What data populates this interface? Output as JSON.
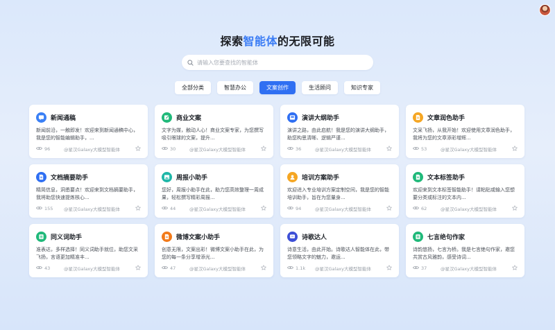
{
  "header": {
    "title_prefix": "探索",
    "title_highlight": "智能体",
    "title_suffix": "的无限可能"
  },
  "search": {
    "placeholder": "请输入您要查找的智能体"
  },
  "tabs": [
    {
      "label": "全部分类",
      "active": false
    },
    {
      "label": "智慧办公",
      "active": false
    },
    {
      "label": "文案创作",
      "active": true
    },
    {
      "label": "生活顾问",
      "active": false
    },
    {
      "label": "知识专家",
      "active": false
    }
  ],
  "cards": [
    {
      "title": "新闻通稿",
      "desc": "新闻前沿，一触即发！欢迎来到新闻通稿中心，我是您的智能编辑助手，...",
      "views": "96",
      "author": "@星汉Galaxy大模型智能体",
      "icon": "message-icon",
      "color": "#3a80f5"
    },
    {
      "title": "商业文案",
      "desc": "文字为媒，触动人心！商业文案专家，为您撰写吸引眼球的文案，提升...",
      "views": "30",
      "author": "@星汉Galaxy大模型智能体",
      "icon": "edit-icon",
      "color": "#20b97a"
    },
    {
      "title": "演讲大纲助手",
      "desc": "演讲之路，由此启航！我是您的演讲大纲助手，助您构思清晰、逻辑严谨...",
      "views": "36",
      "author": "@星汉Galaxy大模型智能体",
      "icon": "inbox-icon",
      "color": "#2f6ff2"
    },
    {
      "title": "文章润色助手",
      "desc": "文采飞扬，从我开始！欢迎使用文章润色助手，我将为您的文章添彩增辉...",
      "views": "53",
      "author": "@星汉Galaxy大模型智能体",
      "icon": "document-icon",
      "color": "#f5a623"
    },
    {
      "title": "文档摘要助手",
      "desc": "精简信息，洞悉要点！欢迎来到文档摘要助手，我将助您快速提炼核心...",
      "views": "155",
      "author": "@星汉Galaxy大模型智能体",
      "icon": "document-icon",
      "color": "#2f6ff2"
    },
    {
      "title": "周报小助手",
      "desc": "您好，周报小助手在此，助力您高效整理一周成果，轻松撰写精彩周报...",
      "views": "44",
      "author": "@星汉Galaxy大模型智能体",
      "icon": "image-icon",
      "color": "#1fb7a8"
    },
    {
      "title": "培训方案助手",
      "desc": "欢迎进入专业培训方案定制空间，我是您的智能培训助手，旨在为您量身...",
      "views": "94",
      "author": "@星汉Galaxy大模型智能体",
      "icon": "user-icon",
      "color": "#f5a623"
    },
    {
      "title": "文本标签助手",
      "desc": "欢迎来到文本标签智能助手！请粘贴或输入您想要分类或标注的文本内...",
      "views": "62",
      "author": "@星汉Galaxy大模型智能体",
      "icon": "document-icon",
      "color": "#20b97a"
    },
    {
      "title": "同义词助手",
      "desc": "准表达，多样选择！同义词助手就位，助您文采飞扬，言语更加精准丰...",
      "views": "43",
      "author": "@星汉Galaxy大模型智能体",
      "icon": "list-icon",
      "color": "#20b97a"
    },
    {
      "title": "微博文案小助手",
      "desc": "创意无限，文案出彩！微博文案小助手在此，为您的每一条分享增添光...",
      "views": "47",
      "author": "@星汉Galaxy大模型智能体",
      "icon": "document-icon",
      "color": "#f27a1a"
    },
    {
      "title": "诗歌达人",
      "desc": "诗意生活，由此开始。诗歌达人智能体在此，带您领略文字的魅力，邀运...",
      "views": "1.1k",
      "author": "@星汉Galaxy大模型智能体",
      "icon": "chat-icon",
      "color": "#3d4fd6"
    },
    {
      "title": "七言绝句作家",
      "desc": "诗韵悠扬，七言为桥。我是七言绝句作家，邀您共赏古风雅韵，感受诗词...",
      "views": "37",
      "author": "@星汉Galaxy大模型智能体",
      "icon": "list-icon",
      "color": "#20b97a"
    }
  ]
}
